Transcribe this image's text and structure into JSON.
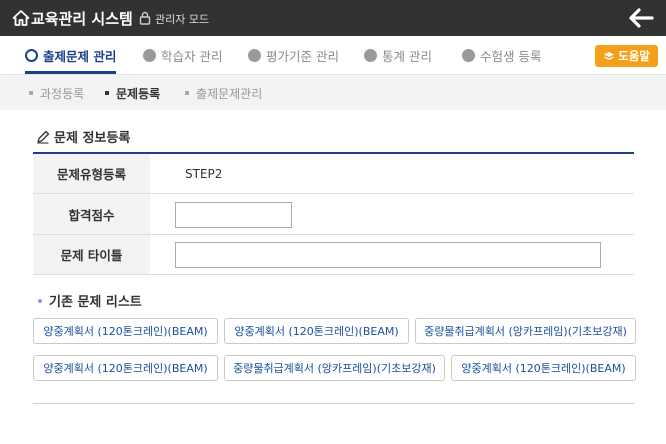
{
  "header": {
    "app_title": "교육관리 시스템",
    "mode_label": "관리자 모드"
  },
  "nav": {
    "items": [
      {
        "label": "출제문제 관리",
        "icon": "square-icon",
        "active": true
      },
      {
        "label": "학습자 관리",
        "icon": "user-icon",
        "active": false
      },
      {
        "label": "평가기준 관리",
        "icon": "list-icon",
        "active": false
      },
      {
        "label": "통계 관리",
        "icon": "chart-icon",
        "active": false
      },
      {
        "label": "수험생 등록",
        "icon": "group-icon",
        "active": false
      }
    ],
    "help_label": "도움말"
  },
  "subnav": {
    "items": [
      {
        "label": "과정등록",
        "active": false
      },
      {
        "label": "문제등록",
        "active": true
      },
      {
        "label": "출제문제관리",
        "active": false
      }
    ]
  },
  "section": {
    "title": "문제 정보등록"
  },
  "form": {
    "type_label": "문제유형등록",
    "type_value": "STEP2",
    "score_label": "합격점수",
    "score_value": "",
    "title_label": "문제 타이틀",
    "title_value": ""
  },
  "existing": {
    "title": "기존 문제 리스트",
    "items": [
      "양중계획서 (120톤크레인)(BEAM)",
      "양중계획서 (120톤크레인)(BEAM)",
      "중량물취급계획서 (앙카프레임)(기초보강재)",
      "양중계획서 (120톤크레인)(BEAM)",
      "중량물취급계획서 (앙카프레임)(기초보강재)",
      "양중계획서 (120톤크레인)(BEAM)"
    ]
  },
  "colors": {
    "header_bg": "#323232",
    "accent": "#1c3f8a",
    "help_button": "#f5a01a",
    "chip_text": "#1c4fa0"
  }
}
